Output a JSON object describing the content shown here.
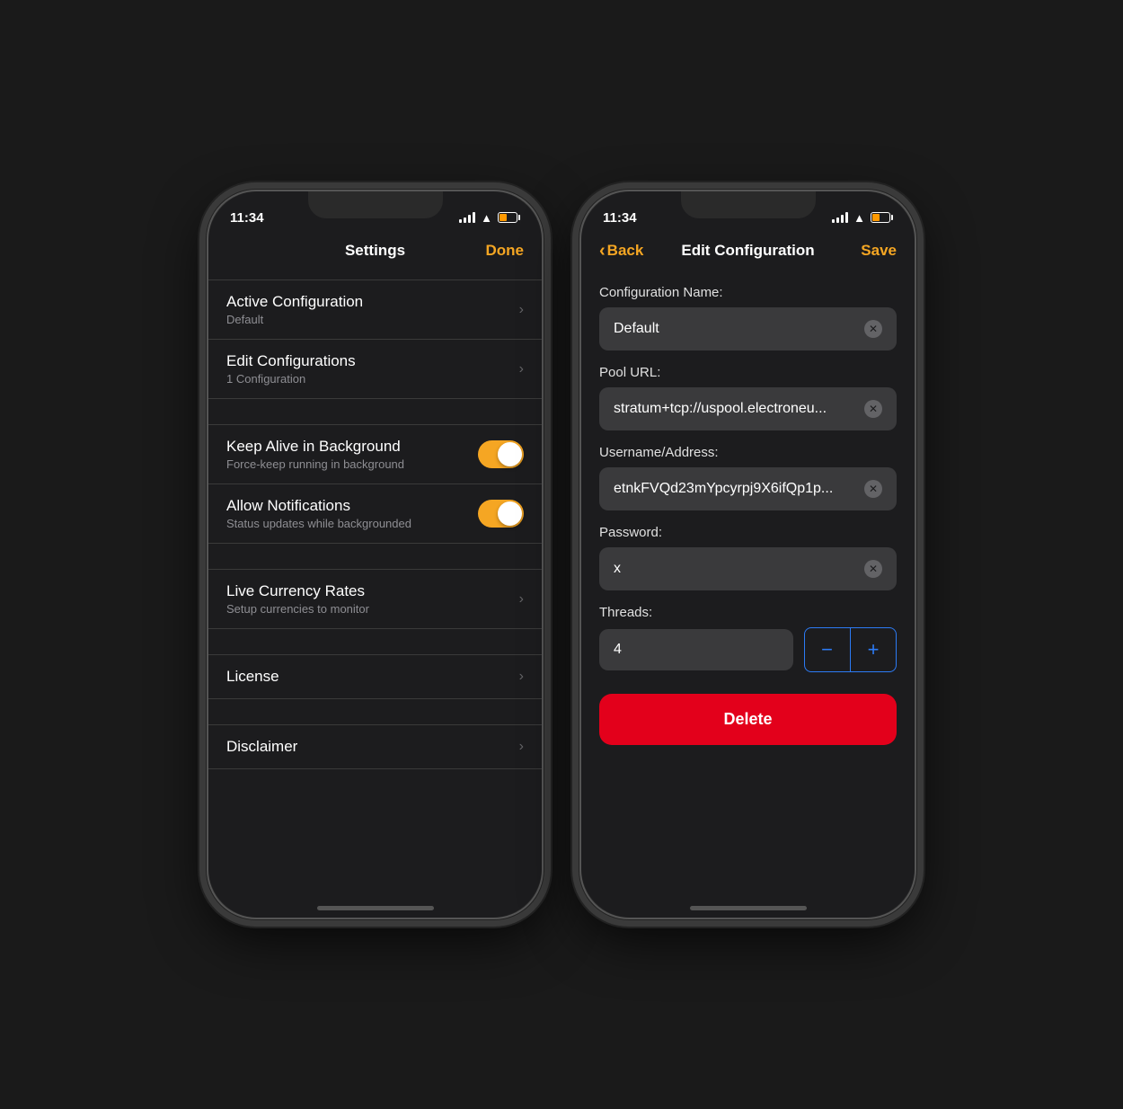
{
  "phone1": {
    "time": "11:34",
    "nav": {
      "title": "Settings",
      "right_btn": "Done"
    },
    "sections": [
      {
        "items": [
          {
            "title": "Active Configuration",
            "subtitle": "Default",
            "type": "nav"
          },
          {
            "title": "Edit Configurations",
            "subtitle": "1 Configuration",
            "type": "nav"
          }
        ]
      },
      {
        "items": [
          {
            "title": "Keep Alive in Background",
            "subtitle": "Force-keep running in background",
            "type": "toggle",
            "value": true
          },
          {
            "title": "Allow Notifications",
            "subtitle": "Status updates while backgrounded",
            "type": "toggle",
            "value": true
          }
        ]
      },
      {
        "items": [
          {
            "title": "Live Currency Rates",
            "subtitle": "Setup currencies to monitor",
            "type": "nav"
          }
        ]
      },
      {
        "items": [
          {
            "title": "License",
            "subtitle": "",
            "type": "nav"
          }
        ]
      },
      {
        "items": [
          {
            "title": "Disclaimer",
            "subtitle": "",
            "type": "nav"
          }
        ]
      }
    ]
  },
  "phone2": {
    "time": "11:34",
    "nav": {
      "back_label": "Back",
      "title": "Edit Configuration",
      "right_btn": "Save"
    },
    "fields": [
      {
        "label": "Configuration Name:",
        "value": "Default",
        "id": "config-name"
      },
      {
        "label": "Pool URL:",
        "value": "stratum+tcp://uspool.electroneu...",
        "id": "pool-url"
      },
      {
        "label": "Username/Address:",
        "value": "etnkFVQd23mYpcyrpj9X6ifQp1p...",
        "id": "username"
      },
      {
        "label": "Password:",
        "value": "x",
        "id": "password"
      }
    ],
    "threads": {
      "label": "Threads:",
      "value": "4",
      "minus": "−",
      "plus": "+"
    },
    "delete_btn": "Delete"
  }
}
